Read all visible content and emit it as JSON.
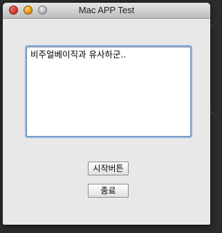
{
  "window": {
    "title": "Mac APP Test"
  },
  "textarea": {
    "value": "비주얼베이직과 유사하군.."
  },
  "buttons": {
    "start_label": "시작버튼",
    "quit_label": "종료"
  },
  "titlebar": {
    "close_icon": "close-icon",
    "minimize_icon": "minimize-icon",
    "zoom_icon": "zoom-icon"
  },
  "colors": {
    "close": "#e0443a",
    "minimize": "#f0a21c",
    "zoom": "#bdbdbd",
    "focus_ring": "#8fb3e0"
  }
}
